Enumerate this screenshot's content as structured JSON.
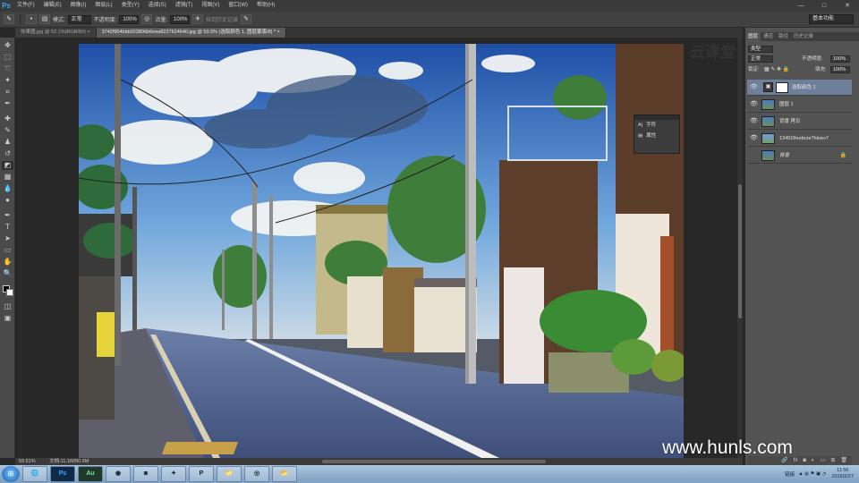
{
  "app": {
    "logo": "Ps"
  },
  "menu": [
    "文件(F)",
    "编辑(E)",
    "图像(I)",
    "图层(L)",
    "类型(Y)",
    "选择(S)",
    "滤镜(T)",
    "视图(V)",
    "窗口(W)",
    "帮助(H)"
  ],
  "window_controls": {
    "minimize": "—",
    "maximize": "□",
    "close": "✕"
  },
  "options": {
    "mode_label": "模式:",
    "mode_value": "正常",
    "opacity_label": "不透明度:",
    "opacity_value": "100%",
    "flow_label": "流量:",
    "flow_value": "100%",
    "history_label": "抹到历史记录",
    "workspace": "基本功能"
  },
  "tabs": [
    {
      "label": "效果图.jpg @ 52.1%(RGB/8#) ×",
      "active": false
    },
    {
      "label": "3742f954bbb923806b6eea8227624640.jpg @ 59.5% (选取颜色 1, 图层蒙版/8) * ×",
      "active": true
    }
  ],
  "status": {
    "zoom": "59.51%",
    "doc": "文档:11.1M/50.6M"
  },
  "panel": {
    "tabs": [
      "图层",
      "通道",
      "路径",
      "历史记录"
    ],
    "kind": "类型",
    "blend_mode": "正常",
    "opacity_label": "不透明度:",
    "opacity_value": "100%",
    "lock_label": "锁定:",
    "fill_label": "填充:",
    "fill_value": "100%"
  },
  "layers": [
    {
      "name": "选取颜色 1",
      "selected": true
    },
    {
      "name": "图层 1",
      "selected": false
    },
    {
      "name": "背景 拷贝",
      "selected": false
    },
    {
      "name": "13491fhrebrze7hkrev7",
      "selected": false
    },
    {
      "name": "背景",
      "selected": false
    }
  ],
  "float_panel": {
    "char": "字符",
    "para": "属性"
  },
  "watermark": {
    "logo": "云课堂",
    "url": "www.hunls.com"
  },
  "taskbar": {
    "apps": [
      "Ps",
      "Au",
      "",
      "",
      "",
      "",
      "",
      "",
      ""
    ],
    "tray_text": "链接",
    "time": "11:56",
    "date": "2016/2/27"
  }
}
